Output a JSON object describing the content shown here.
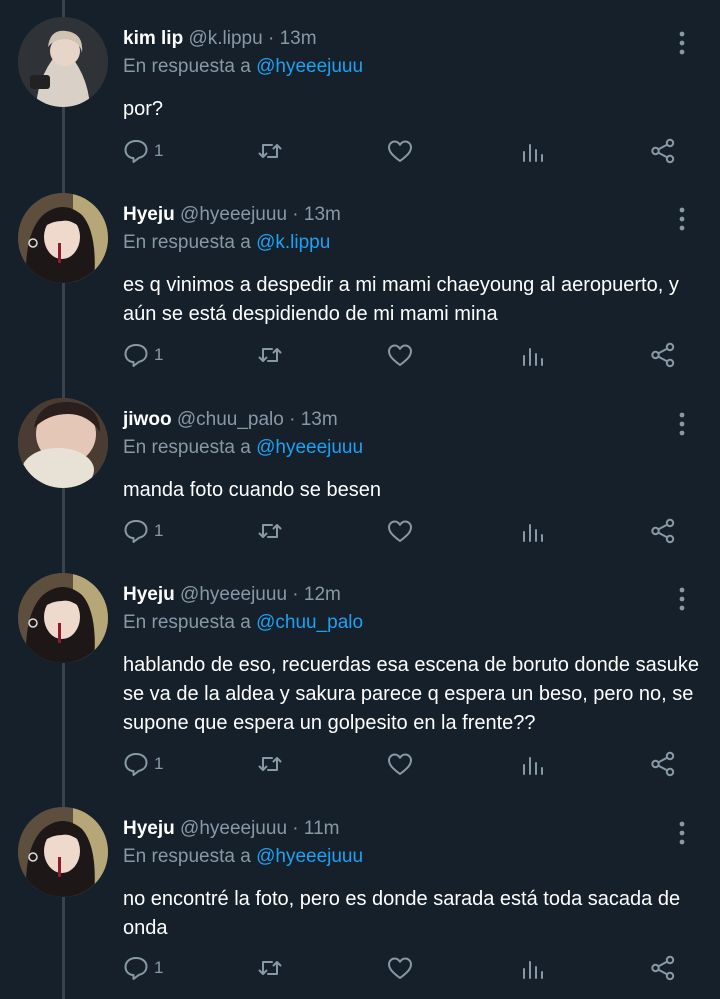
{
  "reply_prefix": "En respuesta a",
  "colors": {
    "background": "#15202b",
    "secondary_text": "#8899a6",
    "mention": "#1da1f2",
    "thread_line": "#38444d"
  },
  "tweets": [
    {
      "name": "kim lip",
      "handle": "@k.lippu",
      "time": "13m",
      "reply_to": "@hyeeejuuu",
      "body": "por?",
      "reply_count": "1"
    },
    {
      "name": "Hyeju",
      "handle": "@hyeeejuuu",
      "time": "13m",
      "reply_to": "@k.lippu",
      "body": "es q vinimos a despedir a mi mami chaeyoung al aeropuerto, y aún se está despidiendo de mi mami mina",
      "reply_count": "1"
    },
    {
      "name": "jiwoo",
      "handle": "@chuu_palo",
      "time": "13m",
      "reply_to": "@hyeeejuuu",
      "body": "manda foto cuando se besen",
      "reply_count": "1"
    },
    {
      "name": "Hyeju",
      "handle": "@hyeeejuuu",
      "time": "12m",
      "reply_to": "@chuu_palo",
      "body": "hablando de eso, recuerdas esa escena de boruto donde sasuke se va de la aldea y sakura parece q espera un beso, pero no, se supone que espera un golpesito en la frente??",
      "reply_count": "1"
    },
    {
      "name": "Hyeju",
      "handle": "@hyeeejuuu",
      "time": "11m",
      "reply_to": "@hyeeejuuu",
      "body": "no encontré la foto, pero es donde sarada está toda sacada de onda",
      "reply_count": "1"
    }
  ]
}
